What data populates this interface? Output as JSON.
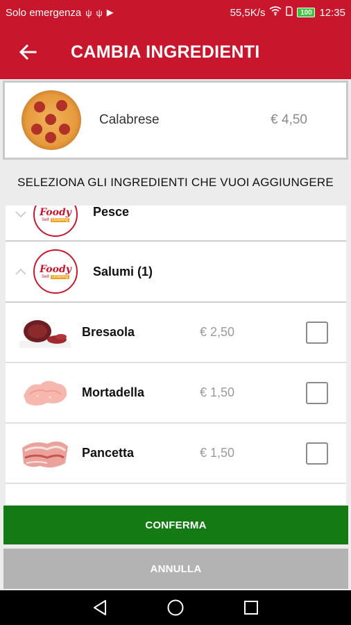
{
  "statusbar": {
    "carrier": "Solo emergenza",
    "speed": "55,5K/s",
    "battery": "100",
    "time": "12:35"
  },
  "appbar": {
    "title": "CAMBIA INGREDIENTI"
  },
  "product": {
    "name": "Calabrese",
    "price": "€ 4,50"
  },
  "heading": "SELEZIONA GLI INGREDIENTI CHE VUOI AGGIUNGERE",
  "logo": {
    "line1": "Foody",
    "line2a": "Self",
    "line2b": "Ordering"
  },
  "categories": [
    {
      "name": "Pesce",
      "expanded": false
    },
    {
      "name": "Salumi (1)",
      "expanded": true
    }
  ],
  "items": [
    {
      "name": "Bresaola",
      "price": "€ 2,50",
      "checked": false
    },
    {
      "name": "Mortadella",
      "price": "€ 1,50",
      "checked": false
    },
    {
      "name": "Pancetta",
      "price": "€ 1,50",
      "checked": false
    }
  ],
  "buttons": {
    "confirm": "CONFERMA",
    "cancel": "ANNULLA"
  },
  "colors": {
    "primary": "#c8162c",
    "confirm": "#137a14",
    "cancel": "#b3b3b3"
  }
}
